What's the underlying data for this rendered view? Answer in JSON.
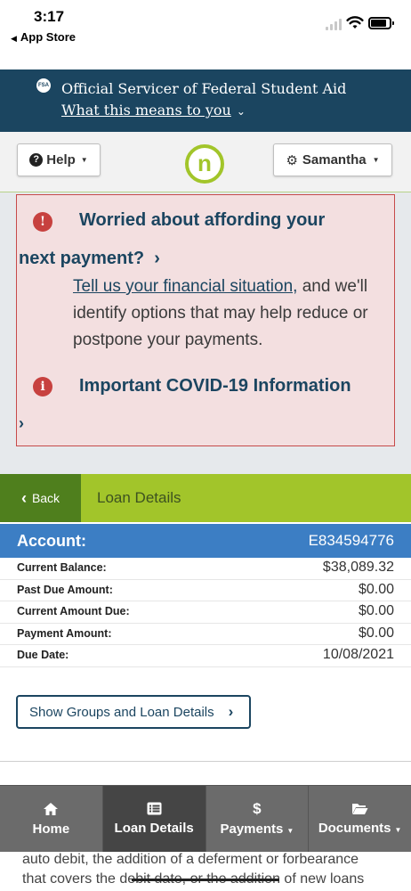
{
  "status_bar": {
    "time": "3:17",
    "back_label": "App Store"
  },
  "fsa_banner": {
    "logo_text": "FSA",
    "title": "Official Servicer of Federal Student Aid",
    "link": "What this means to you"
  },
  "header": {
    "help_label": "Help",
    "logo_letter": "n",
    "user_label": "Samantha"
  },
  "alert": {
    "heading1_line1": "Worried about affording your",
    "heading1_line2": "next payment?",
    "link_text": "Tell us your financial situation,",
    "body_rest": " and we'll identify options that may help reduce or postpone your payments.",
    "heading2": "Important COVID-19 Information",
    "icon_glyph": "!",
    "info_glyph": "i"
  },
  "nav_bar": {
    "back_label": "Back",
    "title": "Loan Details"
  },
  "account": {
    "label": "Account:",
    "number": "E834594776",
    "rows": [
      {
        "label": "Current Balance:",
        "value": "$38,089.32"
      },
      {
        "label": "Past Due Amount:",
        "value": "$0.00"
      },
      {
        "label": "Current Amount Due:",
        "value": "$0.00"
      },
      {
        "label": "Payment Amount:",
        "value": "$0.00"
      },
      {
        "label": "Due Date:",
        "value": "10/08/2021"
      }
    ]
  },
  "show_button": "Show Groups and Loan Details",
  "bottom_nav": [
    {
      "label": "Home",
      "icon": "home-icon"
    },
    {
      "label": "Loan Details",
      "icon": "list-icon"
    },
    {
      "label": "Payments",
      "icon": "dollar-icon"
    },
    {
      "label": "Documents",
      "icon": "folder-icon"
    }
  ],
  "underlying_text": {
    "line1": "auto debit, the addition of a deferment or forbearance",
    "line2": "that covers the debit date, or the addition of new loans"
  },
  "colors": {
    "fsa_blue": "#1b4560",
    "brand_green": "#a2c52a",
    "dark_green": "#4f7f1d",
    "account_blue": "#3c7ec4",
    "alert_red": "#c7413f"
  }
}
